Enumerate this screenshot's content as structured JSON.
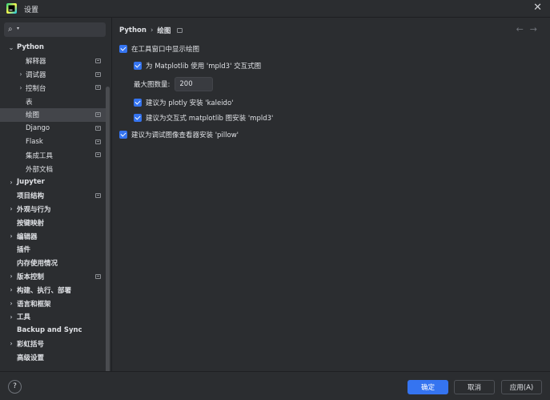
{
  "window": {
    "title": "设置"
  },
  "search": {
    "placeholder": "",
    "value": ""
  },
  "sidebar": {
    "items": [
      {
        "label": "Python",
        "level": 0,
        "bold": true,
        "chevron": "expanded",
        "page_icon": false
      },
      {
        "label": "解释器",
        "level": 1,
        "bold": false,
        "chevron": "none",
        "page_icon": true
      },
      {
        "label": "调试器",
        "level": 1,
        "bold": false,
        "chevron": "collapsed",
        "page_icon": true
      },
      {
        "label": "控制台",
        "level": 1,
        "bold": false,
        "chevron": "collapsed",
        "page_icon": true
      },
      {
        "label": "表",
        "level": 1,
        "bold": false,
        "chevron": "none",
        "page_icon": false
      },
      {
        "label": "绘图",
        "level": 1,
        "bold": false,
        "chevron": "none",
        "page_icon": true,
        "selected": true
      },
      {
        "label": "Django",
        "level": 1,
        "bold": false,
        "chevron": "none",
        "page_icon": true
      },
      {
        "label": "Flask",
        "level": 1,
        "bold": false,
        "chevron": "none",
        "page_icon": true
      },
      {
        "label": "集成工具",
        "level": 1,
        "bold": false,
        "chevron": "none",
        "page_icon": true
      },
      {
        "label": "外部文档",
        "level": 1,
        "bold": false,
        "chevron": "none",
        "page_icon": false
      },
      {
        "label": "Jupyter",
        "level": 0,
        "bold": true,
        "chevron": "collapsed",
        "page_icon": false
      },
      {
        "label": "项目结构",
        "level": 0,
        "bold": true,
        "chevron": "none",
        "page_icon": true
      },
      {
        "label": "外观与行为",
        "level": 0,
        "bold": true,
        "chevron": "collapsed",
        "page_icon": false
      },
      {
        "label": "按键映射",
        "level": 0,
        "bold": true,
        "chevron": "none",
        "page_icon": false
      },
      {
        "label": "编辑器",
        "level": 0,
        "bold": true,
        "chevron": "collapsed",
        "page_icon": false
      },
      {
        "label": "插件",
        "level": 0,
        "bold": true,
        "chevron": "none",
        "page_icon": false
      },
      {
        "label": "内存使用情况",
        "level": 0,
        "bold": true,
        "chevron": "none",
        "page_icon": false
      },
      {
        "label": "版本控制",
        "level": 0,
        "bold": true,
        "chevron": "collapsed",
        "page_icon": true
      },
      {
        "label": "构建、执行、部署",
        "level": 0,
        "bold": true,
        "chevron": "collapsed",
        "page_icon": false
      },
      {
        "label": "语言和框架",
        "level": 0,
        "bold": true,
        "chevron": "collapsed",
        "page_icon": false
      },
      {
        "label": "工具",
        "level": 0,
        "bold": true,
        "chevron": "collapsed",
        "page_icon": false
      },
      {
        "label": "Backup and Sync",
        "level": 0,
        "bold": true,
        "chevron": "none",
        "page_icon": false
      },
      {
        "label": "彩虹括号",
        "level": 0,
        "bold": true,
        "chevron": "collapsed",
        "page_icon": false
      },
      {
        "label": "高级设置",
        "level": 0,
        "bold": true,
        "chevron": "none",
        "page_icon": false
      }
    ]
  },
  "breadcrumb": {
    "parent": "Python",
    "separator": "›",
    "current": "绘图"
  },
  "options": {
    "show_in_toolwindow": {
      "label": "在工具窗口中显示绘图",
      "checked": true
    },
    "use_mpld3": {
      "label": "为 Matplotlib 使用 'mpld3' 交互式图",
      "checked": true
    },
    "max_plots": {
      "label": "最大图数量:",
      "value": "200"
    },
    "suggest_kaleido": {
      "label": "建议为 plotly 安装 'kaleido'",
      "checked": true
    },
    "suggest_mpld3": {
      "label": "建议为交互式 matplotlib 图安装 'mpld3'",
      "checked": true
    },
    "suggest_pillow": {
      "label": "建议为调试图像查看器安装 'pillow'",
      "checked": true
    }
  },
  "footer": {
    "help": "?",
    "ok": "确定",
    "cancel": "取消",
    "apply": "应用(A)"
  },
  "colors": {
    "accent": "#3574f0",
    "background": "#2b2d30",
    "selected": "#43454a"
  }
}
